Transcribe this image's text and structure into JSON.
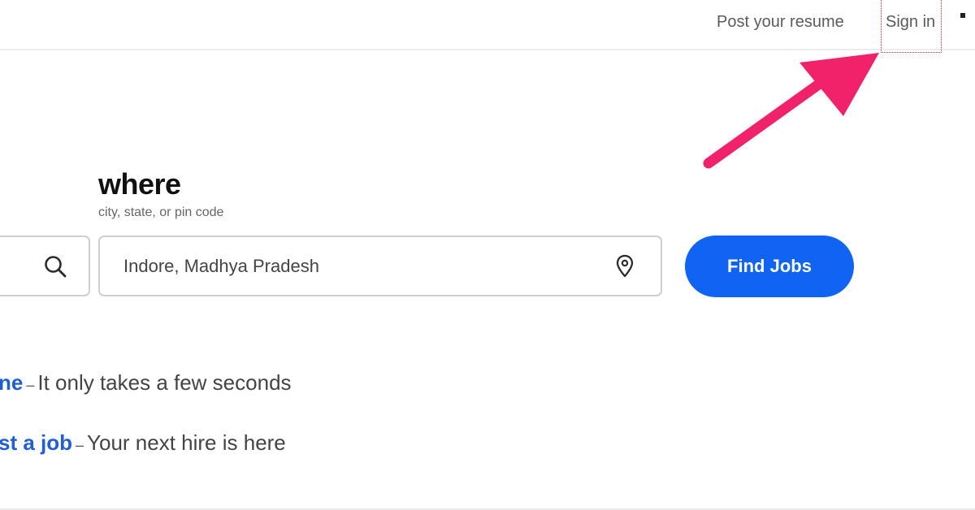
{
  "header": {
    "post_resume": "Post your resume",
    "sign_in": "Sign in"
  },
  "search": {
    "where_title": "where",
    "where_subtitle": "city, state, or pin code",
    "where_value": "Indore, Madhya Pradesh",
    "find_jobs_label": "Find Jobs"
  },
  "promo": {
    "line1_link": "ne",
    "line1_dash": "–",
    "line1_text": "It only takes a few seconds",
    "line2_link": "st a job",
    "line2_dash": "–",
    "line2_text": "Your next hire is here"
  },
  "icons": {
    "search": "search-icon",
    "location": "location-pin-icon",
    "annotation": "arrow-annotation"
  },
  "colors": {
    "brand_blue": "#1164f3",
    "link_blue": "#1f5ed6",
    "annotation_arrow": "#f2226a"
  }
}
